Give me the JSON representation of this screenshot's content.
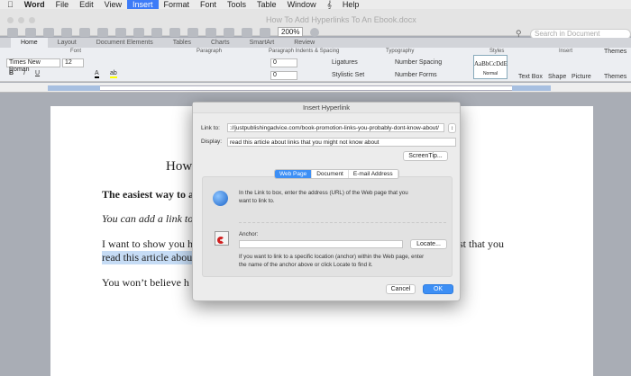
{
  "menubar": {
    "items": [
      "Word",
      "File",
      "Edit",
      "View",
      "Insert",
      "Format",
      "Font",
      "Tools",
      "Table",
      "Window",
      "Help"
    ],
    "active": "Insert"
  },
  "window": {
    "title": "How To Add Hyperlinks To An Ebook.docx",
    "zoom": "200%",
    "search_placeholder": "Search in Document"
  },
  "ribbon": {
    "tabs": [
      "Home",
      "Layout",
      "Document Elements",
      "Tables",
      "Charts",
      "SmartArt",
      "Review"
    ],
    "groups": {
      "font": "Font",
      "paragraph": "Paragraph",
      "indents": "Paragraph Indents & Spacing",
      "typography": "Typography",
      "styles": "Styles",
      "insert": "Insert",
      "themes": "Themes"
    },
    "font_name": "Times New Roman",
    "font_size": "12",
    "indent_value": "0",
    "ligatures": "Ligatures",
    "number_spacing": "Number Spacing",
    "stylistic_set": "Stylistic Set",
    "number_forms": "Number Forms",
    "style_preview": "AaBbCcDdE",
    "style_name": "Normal",
    "text_box": "Text Box",
    "shape": "Shape",
    "picture": "Picture",
    "themes_btn": "Themes"
  },
  "document": {
    "title_partial": "How",
    "p1": "The easiest way to a",
    "p2": "You can add a link to",
    "p3a": "I want to show you h",
    "p3b": "st that you",
    "p3c": "read this article abou",
    "p4": "You won’t believe h"
  },
  "dialog": {
    "title": "Insert Hyperlink",
    "link_label": "Link to:",
    "link_value": "://justpublishingadvice.com/book-promotion-links-you-probably-dont-know-about/",
    "display_label": "Display:",
    "display_value": "read this article about links that you might not know about",
    "screentip": "ScreenTip...",
    "tabs": [
      "Web Page",
      "Document",
      "E-mail Address"
    ],
    "web_help": "In the Link to box, enter the address (URL) of the Web page that you want to link to.",
    "anchor_label": "Anchor:",
    "anchor_value": "",
    "locate": "Locate...",
    "anchor_help": "If you want to link to a specific location (anchor) within the Web page, enter the name of the anchor above or click Locate to find it.",
    "cancel": "Cancel",
    "ok": "OK"
  }
}
